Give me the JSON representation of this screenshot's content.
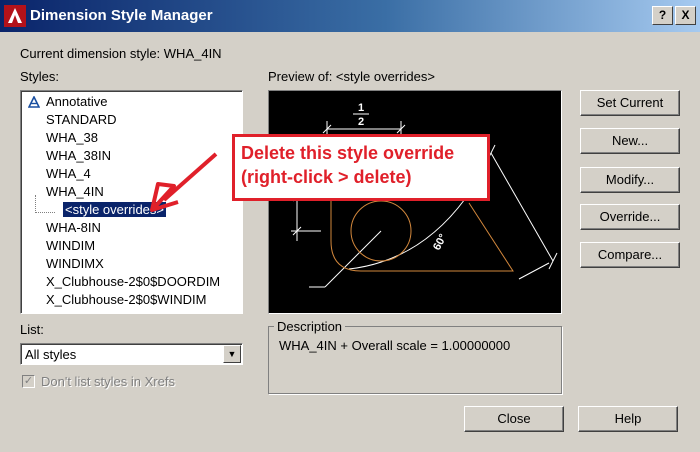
{
  "window": {
    "title": "Dimension Style Manager",
    "buttons": {
      "help": "?",
      "close": "X"
    }
  },
  "current_style": {
    "label": "Current dimension style: WHA_4IN"
  },
  "styles": {
    "label": "Styles:",
    "items": [
      {
        "label": "Annotative",
        "icon": "annotative-icon"
      },
      {
        "label": "STANDARD"
      },
      {
        "label": "WHA_38"
      },
      {
        "label": "WHA_38IN"
      },
      {
        "label": "WHA_4"
      },
      {
        "label": "WHA_4IN"
      },
      {
        "label": "<style overrides>",
        "selected": true
      },
      {
        "label": "WHA-8IN"
      },
      {
        "label": "WINDIM"
      },
      {
        "label": "WINDIMX"
      },
      {
        "label": "X_Clubhouse-2$0$DOORDIM"
      },
      {
        "label": "X_Clubhouse-2$0$WINDIM"
      }
    ]
  },
  "preview": {
    "label": "Preview of: <style overrides>",
    "dimension_texts": {
      "fraction_top": "1",
      "fraction_bottom": "2",
      "angle": "60°"
    }
  },
  "buttons": {
    "set_current": "Set Current",
    "new": "New...",
    "modify": "Modify...",
    "override": "Override...",
    "compare": "Compare...",
    "close": "Close",
    "help": "Help"
  },
  "annotation": {
    "line1": "Delete this style override",
    "line2": "(right-click > delete)",
    "color": "#e0202a"
  },
  "list": {
    "label": "List:",
    "selected": "All styles"
  },
  "xrefs_checkbox": {
    "label": "Don't list styles in Xrefs",
    "checked": true,
    "disabled": true
  },
  "description": {
    "label": "Description",
    "text": "WHA_4IN + Overall scale = 1.00000000"
  },
  "colors": {
    "titlebar_start": "#0a246a",
    "dialog_bg": "#d4d0c8",
    "selection": "#0a246a",
    "preview_lines": "#ffffff",
    "preview_shapes": "#d2873c"
  }
}
